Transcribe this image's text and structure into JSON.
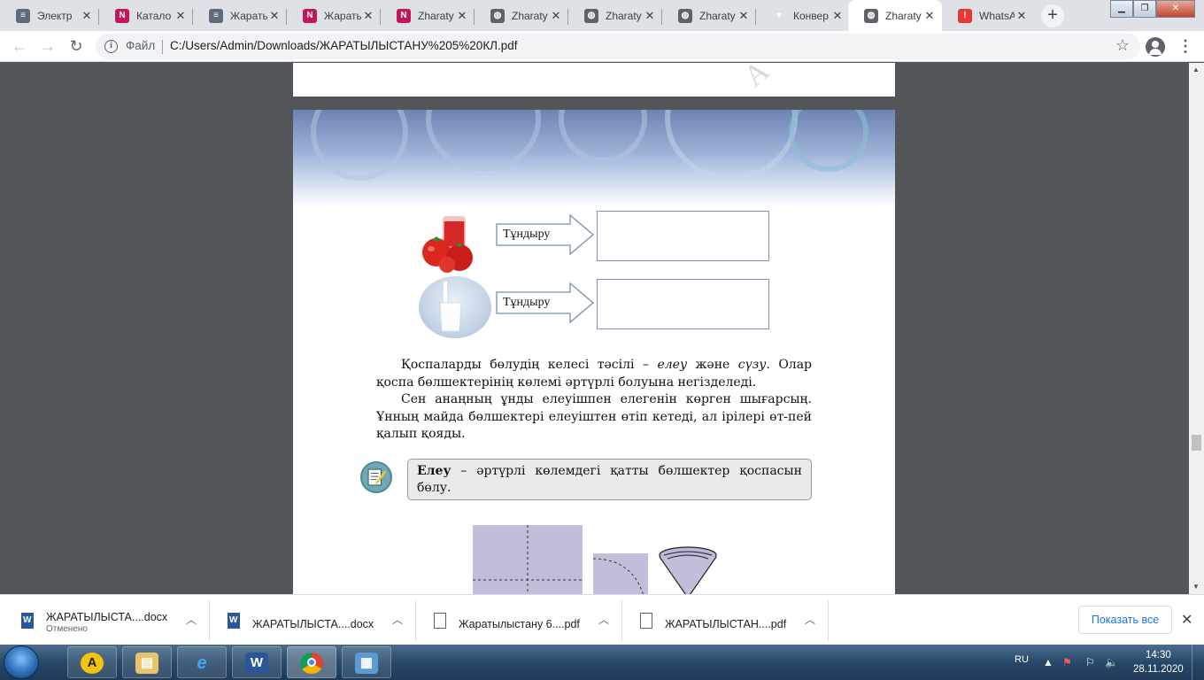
{
  "browser": {
    "tabs": [
      {
        "title": "Электр",
        "icon": "book-icon",
        "active": false
      },
      {
        "title": "Катало",
        "icon": "doc-red-icon",
        "active": false
      },
      {
        "title": "Жарать",
        "icon": "book-icon",
        "active": false
      },
      {
        "title": "Жарать",
        "icon": "doc-red-icon",
        "active": false
      },
      {
        "title": "Zharaty",
        "icon": "doc-red-icon",
        "active": false
      },
      {
        "title": "Zharaty",
        "icon": "globe-icon",
        "active": false
      },
      {
        "title": "Zharaty",
        "icon": "globe-icon",
        "active": false
      },
      {
        "title": "Zharaty",
        "icon": "globe-icon",
        "active": false
      },
      {
        "title": "Конвер",
        "icon": "heart-icon",
        "active": false
      },
      {
        "title": "Zharaty",
        "icon": "globe-icon",
        "active": true
      },
      {
        "title": "WhatsA",
        "icon": "alert-icon",
        "active": false
      }
    ],
    "omnibox": {
      "scheme_label": "Файл",
      "url": "C:/Users/Admin/Downloads/ЖАРАТЫЛЫСТАНУ%205%20КЛ.pdf"
    }
  },
  "pdf": {
    "arrow_label_1": "Тұндыру",
    "arrow_label_2": "Тұндыру",
    "para1": [
      "Қоспаларды бөлудің келесі тәсілі – ",
      "елеу",
      " және ",
      "сүзу",
      ". Олар қоспа бөлшектерінің көлемі әртүрлі болуына негізделеді."
    ],
    "para2": "Сен анаңның ұнды елеуішпен елегенін көрген шығарсың. Ұнның майда бөлшектері елеуіштен өтіп кетеді, ал ірілері өт-пей қалып қояды.",
    "definition_term": "Елеу",
    "definition_text": " – әртүрлі көлемдегі қатты бөлшектер қоспасын бөлу."
  },
  "downloads": [
    {
      "name": "ЖАРАТЫЛЫСТА....docx",
      "status": "Отменено",
      "type": "word"
    },
    {
      "name": "ЖАРАТЫЛЫСТА....docx",
      "status": "",
      "type": "word"
    },
    {
      "name": "Жаратылыстану 6....pdf",
      "status": "",
      "type": "file"
    },
    {
      "name": "ЖАРАТЫЛЫСТАН....pdf",
      "status": "",
      "type": "file"
    }
  ],
  "downloads_show_all": "Показать все",
  "taskbar": {
    "lang": "RU",
    "time": "14:30",
    "date": "28.11.2020"
  },
  "colors": {
    "accent": "#1a73e8",
    "banner": "#6c84b4",
    "figure": "#c3bddc"
  }
}
